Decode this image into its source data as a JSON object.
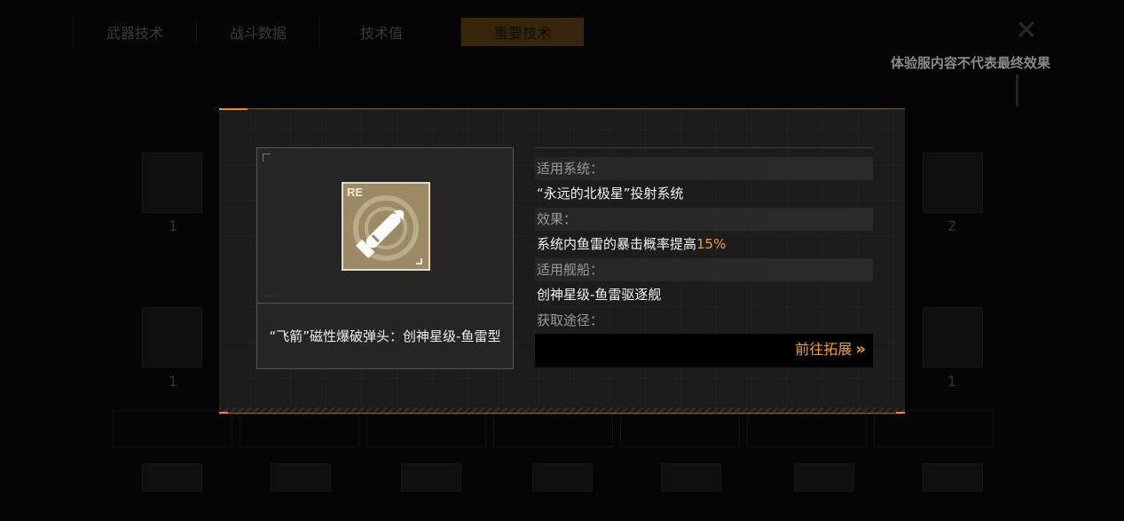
{
  "background": {
    "tabs": [
      "武器技术",
      "战斗数据",
      "技术值",
      "重要技术"
    ],
    "notice": "体验服内容不代表最终效果",
    "close_icon": "close-icon",
    "side_numbers": [
      "1",
      "2",
      "1",
      "1"
    ]
  },
  "modal": {
    "item": {
      "badge": "RE",
      "icon": "torpedo-warhead-icon",
      "name": "“飞箭”磁性爆破弹头：创神星级-鱼雷型"
    },
    "applicable_system_label": "适用系统：",
    "applicable_system_value": "“永远的北极星”投射系统",
    "effect_label": "效果：",
    "effect_value_prefix": "系统内鱼雷的暴击概率提高",
    "effect_value_highlight": "15%",
    "applicable_ship_label": "适用舰船：",
    "applicable_ship_value": "创神星级-鱼雷驱逐舰",
    "source_label": "获取途径：",
    "goto_button": "前往拓展",
    "goto_icon": "double-chevron-right-icon"
  },
  "colors": {
    "accent": "#f0a030",
    "modal_bg": "#1c1c1c"
  }
}
